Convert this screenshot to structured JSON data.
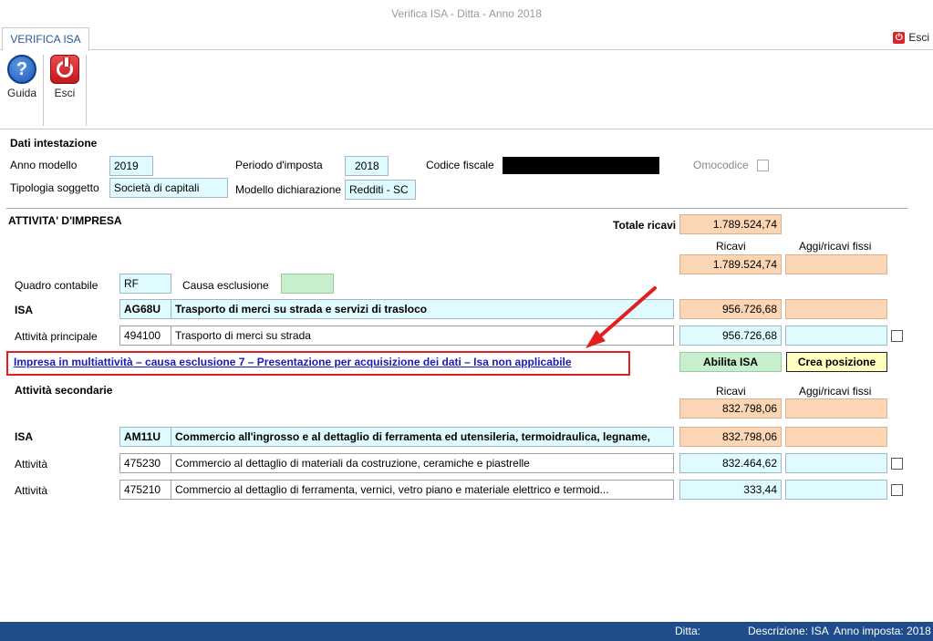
{
  "window": {
    "title": "Verifica ISA - Ditta            - Anno 2018"
  },
  "tabs": [
    {
      "label": "VERIFICA ISA"
    }
  ],
  "top_exit": {
    "label": "Esci"
  },
  "ribbon": {
    "help_label": "Guida",
    "exit_label": "Esci"
  },
  "header": {
    "section_title": "Dati intestazione",
    "anno_modello_label": "Anno modello",
    "anno_modello_value": "2019",
    "periodo_label": "Periodo d'imposta",
    "periodo_value": "2018",
    "codice_fiscale_label": "Codice fiscale",
    "codice_fiscale_value": "",
    "omocodice_label": "Omocodice",
    "tipologia_label": "Tipologia soggetto",
    "tipologia_value": "Società di capitali",
    "modello_label": "Modello dichiarazione",
    "modello_value": "Redditi - SC"
  },
  "impresa": {
    "section_title": "ATTIVITA' D'IMPRESA",
    "totale_ricavi_label": "Totale ricavi",
    "totale_ricavi_value": "1.789.524,74",
    "col_ricavi": "Ricavi",
    "col_aggi": "Aggi/ricavi fissi",
    "ricavi_value": "1.789.524,74",
    "quadro_label": "Quadro contabile",
    "quadro_value": "RF",
    "causa_label": "Causa esclusione",
    "causa_value": ""
  },
  "principale": {
    "isa_label": "ISA",
    "isa_code": "AG68U",
    "isa_desc": "Trasporto di merci su strada e servizi di trasloco",
    "isa_ricavi": "956.726,68",
    "attivita_label": "Attività principale",
    "attivita_code": "494100",
    "attivita_desc": "Trasporto di merci su strada",
    "attivita_ricavi": "956.726,68"
  },
  "warning": {
    "text": "Impresa in multiattività – causa esclusione 7 – Presentazione per acquisizione dei dati – Isa non applicabile",
    "abilita_label": "Abilita ISA",
    "crea_label": "Crea posizione"
  },
  "secondarie": {
    "section_title": "Attività secondarie",
    "col_ricavi": "Ricavi",
    "col_aggi": "Aggi/ricavi fissi",
    "ricavi_value": "832.798,06",
    "isa_label": "ISA",
    "isa_code": "AM11U",
    "isa_desc": "Commercio all'ingrosso e al dettaglio di ferramenta ed utensileria, termoidraulica, legname,",
    "isa_ricavi": "832.798,06",
    "rows": [
      {
        "label": "Attività",
        "code": "475230",
        "desc": "Commercio al dettaglio di materiali da costruzione, ceramiche e piastrelle",
        "ricavi": "832.464,62"
      },
      {
        "label": "Attività",
        "code": "475210",
        "desc": "Commercio al dettaglio di ferramenta, vernici, vetro piano e materiale elettrico e termoid...",
        "ricavi": "333,44"
      }
    ]
  },
  "statusbar": {
    "ditta": "Ditta:",
    "descrizione": "Descrizione: ISA",
    "anno": "Anno imposta: 2018"
  },
  "colors": {
    "peach": "#fcd5b4",
    "cyan": "#e0fbff",
    "green": "#c6efce",
    "status_blue": "#1f4d8b",
    "warning_red": "#e02020",
    "link_blue": "#1a1ab8"
  }
}
